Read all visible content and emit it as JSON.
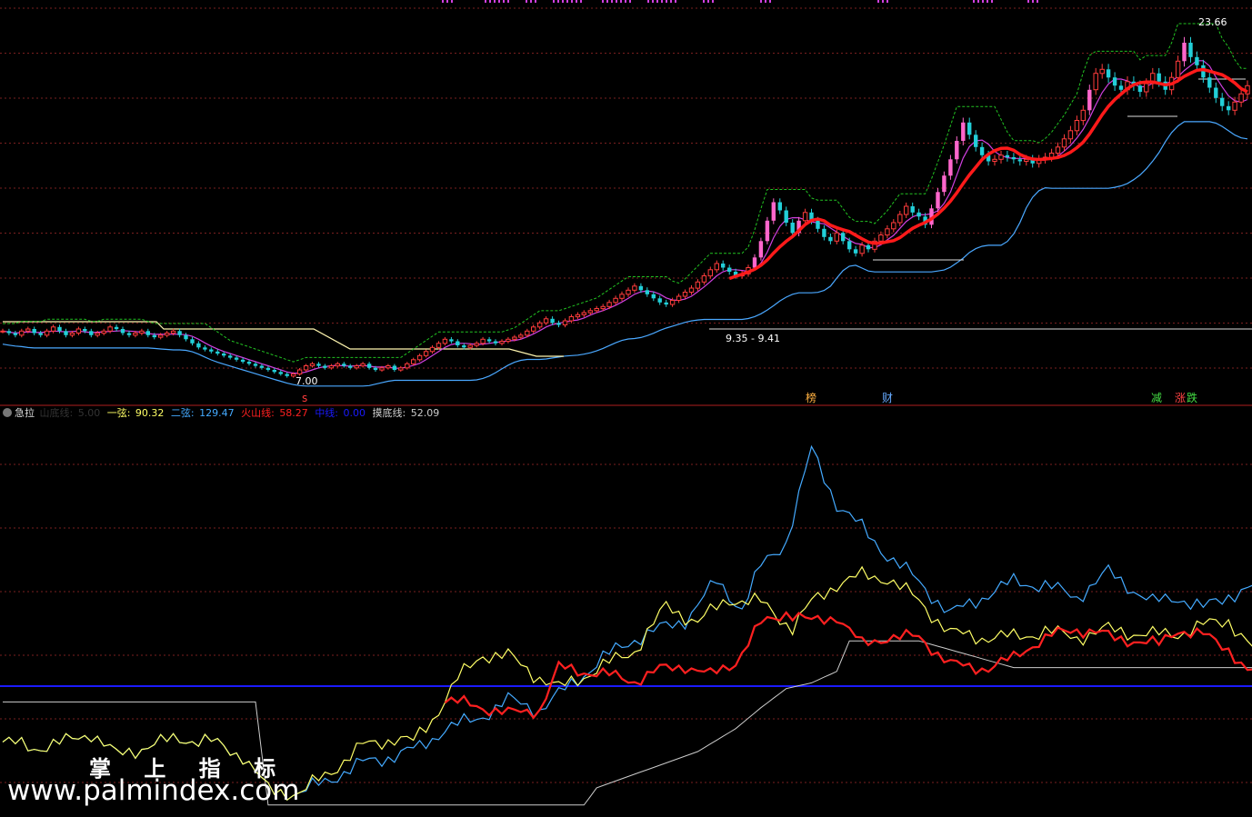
{
  "colors": {
    "background": "#000000",
    "grid": "#7a1f1f",
    "separator": "#b01e1e",
    "candle_up": "#ff3c3c",
    "candle_down": "#22cfd8",
    "candle_big_up": "#ff66cc",
    "upper_band": "#22c322",
    "ma_red": "#ff1a1a",
    "ma_magenta": "#d040e0",
    "support": "#4aa8ff",
    "resistance": "#fff6b0",
    "top_marks": "#d040e0",
    "yixian": "#ffff66",
    "erxian": "#44aaff",
    "huoshan": "#ff2020",
    "zhongxian": "#1a1aff",
    "modi": "#cccccc"
  },
  "main_panel": {
    "price_annotations": {
      "high": "23.66",
      "low": "7.00",
      "mid_range": "9.35 - 9.41"
    },
    "signal_labels": [
      {
        "text": "s",
        "color": "#ff3c3c"
      },
      {
        "text": "榜",
        "color": "#ffb040"
      },
      {
        "text": "财",
        "color": "#66aaff"
      },
      {
        "text": "减",
        "color": "#44dd44"
      },
      {
        "text": "涨",
        "color": "#ff4444"
      },
      {
        "text": "跌",
        "color": "#44dd44"
      }
    ]
  },
  "indicator_panel": {
    "name": "急拉",
    "items": [
      {
        "label": "山底线: ",
        "value": "5.00",
        "color": "#333333"
      },
      {
        "label": "一弦: ",
        "value": "90.32",
        "color": "#ffff66"
      },
      {
        "label": "二弦: ",
        "value": "129.47",
        "color": "#44aaff"
      },
      {
        "label": "火山线: ",
        "value": "58.27",
        "color": "#ff2020"
      },
      {
        "label": "中线: ",
        "value": "0.00",
        "color": "#1a1aff"
      },
      {
        "label": "摸底线: ",
        "value": "52.09",
        "color": "#cccccc"
      }
    ]
  },
  "watermark": {
    "line1": "掌 上 指 标",
    "line2": "www.palmindex.com"
  },
  "chart_data": [
    {
      "type": "candlestick",
      "title": "",
      "n_bars": 200,
      "price_range_visible": [
        6.5,
        24.5
      ],
      "annotated_high": 23.66,
      "annotated_low": 7.0,
      "close": [
        9.2,
        9.1,
        9.0,
        9.2,
        9.3,
        9.1,
        9.0,
        9.2,
        9.4,
        9.2,
        9.0,
        9.1,
        9.3,
        9.2,
        9.0,
        9.1,
        9.2,
        9.4,
        9.3,
        9.1,
        9.0,
        9.1,
        9.2,
        9.0,
        8.9,
        9.0,
        9.1,
        9.2,
        9.0,
        8.8,
        8.6,
        8.4,
        8.3,
        8.2,
        8.1,
        8.0,
        7.9,
        7.8,
        7.7,
        7.6,
        7.5,
        7.4,
        7.3,
        7.2,
        7.1,
        7.0,
        7.1,
        7.3,
        7.5,
        7.6,
        7.5,
        7.4,
        7.5,
        7.6,
        7.5,
        7.4,
        7.5,
        7.6,
        7.4,
        7.3,
        7.4,
        7.5,
        7.3,
        7.4,
        7.6,
        7.8,
        8.0,
        8.2,
        8.4,
        8.6,
        8.8,
        8.7,
        8.5,
        8.4,
        8.5,
        8.6,
        8.8,
        8.7,
        8.6,
        8.7,
        8.8,
        8.9,
        9.0,
        9.2,
        9.4,
        9.6,
        9.8,
        9.6,
        9.5,
        9.7,
        9.9,
        10.0,
        10.1,
        10.2,
        10.3,
        10.4,
        10.6,
        10.8,
        11.0,
        11.2,
        11.4,
        11.2,
        11.0,
        10.8,
        10.6,
        10.5,
        10.7,
        10.9,
        11.1,
        11.3,
        11.6,
        11.9,
        12.2,
        12.5,
        12.3,
        12.1,
        11.9,
        12.0,
        12.3,
        12.8,
        13.6,
        14.6,
        15.5,
        15.1,
        14.5,
        14.0,
        14.6,
        15.0,
        14.6,
        14.2,
        13.8,
        13.6,
        14.0,
        13.6,
        13.2,
        13.0,
        13.4,
        13.2,
        13.6,
        13.9,
        14.2,
        14.5,
        14.9,
        15.3,
        15.0,
        14.8,
        14.4,
        15.2,
        16.0,
        16.8,
        17.6,
        18.5,
        19.4,
        18.8,
        18.2,
        17.8,
        17.5,
        17.6,
        17.8,
        17.7,
        17.6,
        17.5,
        17.6,
        17.4,
        17.6,
        17.7,
        17.9,
        18.2,
        18.6,
        19.0,
        19.5,
        20.0,
        21.0,
        21.8,
        22.0,
        21.6,
        21.2,
        21.0,
        21.4,
        21.2,
        20.9,
        21.3,
        21.8,
        21.4,
        21.0,
        21.6,
        22.4,
        23.3,
        22.6,
        22.2,
        21.6,
        21.1,
        20.6,
        20.2,
        20.0,
        20.4,
        20.8,
        21.2
      ],
      "series": [
        {
          "name": "upper_band",
          "style": "dashed",
          "color": "upper_band"
        },
        {
          "name": "ma_red",
          "style": "thick",
          "color": "ma_red"
        },
        {
          "name": "ma_magenta",
          "color": "ma_magenta"
        },
        {
          "name": "support",
          "color": "support"
        },
        {
          "name": "resistance",
          "color": "resistance"
        }
      ]
    },
    {
      "type": "line",
      "title": "急拉",
      "n_points": 200,
      "ylim": [
        0,
        200
      ],
      "series": [
        {
          "name": "一弦",
          "color": "yixian",
          "keypoints": [
            [
              0,
              35
            ],
            [
              5,
              32
            ],
            [
              10,
              35
            ],
            [
              14,
              40
            ],
            [
              18,
              28
            ],
            [
              23,
              33
            ],
            [
              28,
              37
            ],
            [
              33,
              35
            ],
            [
              38,
              28
            ],
            [
              42,
              10
            ],
            [
              47,
              8
            ],
            [
              52,
              20
            ],
            [
              57,
              33
            ],
            [
              62,
              37
            ],
            [
              65,
              35
            ],
            [
              68,
              47
            ],
            [
              72,
              68
            ],
            [
              76,
              81
            ],
            [
              80,
              80
            ],
            [
              84,
              71
            ],
            [
              88,
              63
            ],
            [
              94,
              73
            ],
            [
              100,
              83
            ],
            [
              105,
              106
            ],
            [
              110,
              98
            ],
            [
              115,
              110
            ],
            [
              120,
              108
            ],
            [
              125,
              95
            ],
            [
              128,
              108
            ],
            [
              132,
              118
            ],
            [
              136,
              122
            ],
            [
              140,
              121
            ],
            [
              145,
              109
            ],
            [
              150,
              92
            ],
            [
              155,
              90
            ],
            [
              160,
              90
            ],
            [
              165,
              93
            ],
            [
              170,
              90
            ],
            [
              175,
              94
            ],
            [
              182,
              91
            ],
            [
              186,
              92
            ],
            [
              190,
              96
            ],
            [
              194,
              99
            ],
            [
              199,
              79
            ]
          ]
        },
        {
          "name": "二弦",
          "color": "erxian",
          "keypoints": [
            [
              0,
              35
            ],
            [
              5,
              32
            ],
            [
              10,
              35
            ],
            [
              14,
              40
            ],
            [
              18,
              28
            ],
            [
              23,
              33
            ],
            [
              28,
              37
            ],
            [
              33,
              35
            ],
            [
              38,
              28
            ],
            [
              42,
              10
            ],
            [
              47,
              8
            ],
            [
              52,
              16
            ],
            [
              57,
              24
            ],
            [
              62,
              28
            ],
            [
              66,
              32
            ],
            [
              70,
              42
            ],
            [
              75,
              47
            ],
            [
              80,
              57
            ],
            [
              85,
              52
            ],
            [
              90,
              65
            ],
            [
              95,
              79
            ],
            [
              100,
              89
            ],
            [
              103,
              93
            ],
            [
              108,
              99
            ],
            [
              113,
              119
            ],
            [
              117,
              105
            ],
            [
              120,
              127
            ],
            [
              124,
              140
            ],
            [
              128,
              188
            ],
            [
              132,
              160
            ],
            [
              136,
              147
            ],
            [
              140,
              133
            ],
            [
              145,
              119
            ],
            [
              150,
              102
            ],
            [
              155,
              111
            ],
            [
              160,
              119
            ],
            [
              165,
              117
            ],
            [
              170,
              111
            ],
            [
              175,
              124
            ],
            [
              182,
              108
            ],
            [
              186,
              111
            ],
            [
              190,
              105
            ],
            [
              194,
              112
            ],
            [
              199,
              117
            ]
          ]
        },
        {
          "name": "火山线",
          "color": "huoshan",
          "keypoints": [
            [
              70,
              57
            ],
            [
              75,
              54
            ],
            [
              80,
              50
            ],
            [
              85,
              52
            ],
            [
              88,
              74
            ],
            [
              92,
              72
            ],
            [
              96,
              70
            ],
            [
              100,
              67
            ],
            [
              104,
              73
            ],
            [
              108,
              75
            ],
            [
              112,
              70
            ],
            [
              116,
              77
            ],
            [
              120,
              97
            ],
            [
              124,
              103
            ],
            [
              128,
              98
            ],
            [
              132,
              101
            ],
            [
              136,
              86
            ],
            [
              140,
              90
            ],
            [
              145,
              90
            ],
            [
              150,
              76
            ],
            [
              153,
              74
            ],
            [
              156,
              74
            ],
            [
              160,
              79
            ],
            [
              163,
              86
            ],
            [
              166,
              91
            ],
            [
              170,
              94
            ],
            [
              173,
              93
            ],
            [
              176,
              89
            ],
            [
              180,
              88
            ],
            [
              183,
              86
            ],
            [
              186,
              94
            ],
            [
              190,
              91
            ],
            [
              194,
              84
            ],
            [
              197,
              72
            ],
            [
              199,
              72
            ]
          ]
        },
        {
          "name": "中线",
          "color": "zhongxian",
          "value": 0
        },
        {
          "name": "摸底线",
          "color": "modi",
          "keypoints": [
            [
              0,
              56
            ],
            [
              40,
              56
            ],
            [
              42,
              2
            ],
            [
              92,
              2
            ],
            [
              94,
              11
            ],
            [
              110,
              30
            ],
            [
              116,
              42
            ],
            [
              120,
              53
            ],
            [
              124,
              63
            ],
            [
              128,
              66
            ],
            [
              132,
              72
            ],
            [
              134,
              88
            ],
            [
              140,
              88
            ],
            [
              145,
              88
            ],
            [
              160,
              74
            ],
            [
              180,
              74
            ],
            [
              199,
              74
            ]
          ]
        }
      ]
    }
  ]
}
